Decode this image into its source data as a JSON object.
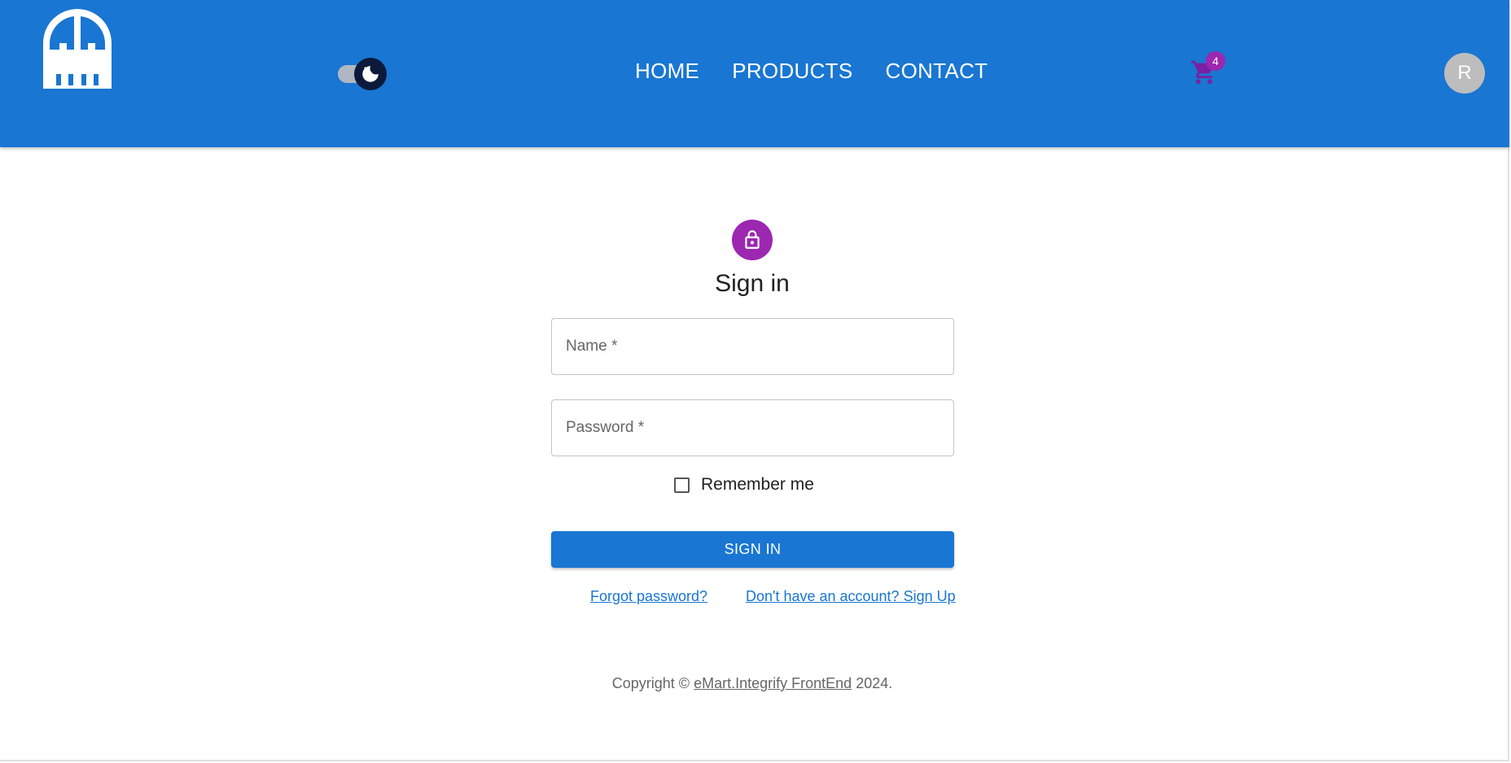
{
  "header": {
    "logo_icon": "castle-gate-icon",
    "theme_toggle_icon": "moon-icon",
    "nav": [
      {
        "label": "HOME"
      },
      {
        "label": "PRODUCTS"
      },
      {
        "label": "CONTACT"
      }
    ],
    "cart": {
      "icon": "shopping-cart-icon",
      "badge_count": "4"
    },
    "avatar_initial": "R"
  },
  "signin": {
    "icon": "lock-icon",
    "title": "Sign in",
    "name_placeholder": "Name *",
    "password_placeholder": "Password *",
    "remember_label": "Remember me",
    "submit_label": "SIGN IN",
    "forgot_link": "Forgot password?",
    "signup_link": "Don't have an account? Sign Up"
  },
  "footer": {
    "prefix": "Copyright ©",
    "brand": "eMart.Integrify FrontEnd",
    "year": "2024."
  },
  "colors": {
    "primary": "#1976d2",
    "secondary": "#9c27b0",
    "avatar_bg": "#bdbdbd",
    "cart_icon": "#7b1fa2"
  }
}
